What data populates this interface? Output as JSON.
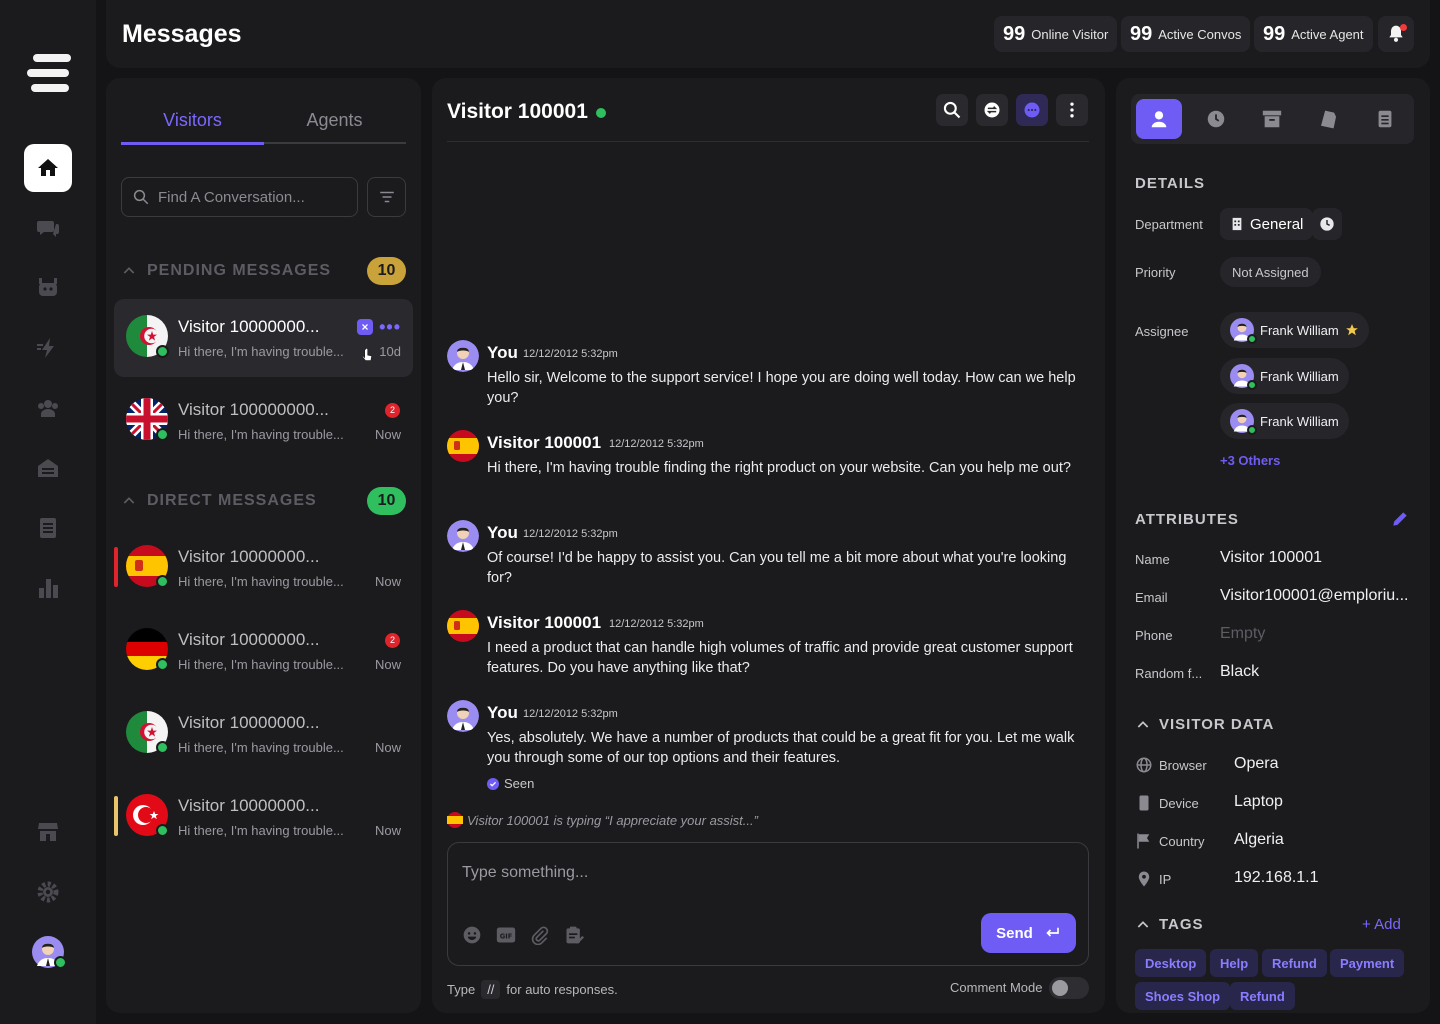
{
  "header": {
    "title": "Messages",
    "stats": [
      {
        "value": "99",
        "label": "Online Visitor"
      },
      {
        "value": "99",
        "label": "Active Convos"
      },
      {
        "value": "99",
        "label": "Active Agent"
      }
    ]
  },
  "sidebar_nav": [
    "home-icon",
    "chat-icon",
    "bot-icon",
    "lightning-icon",
    "team-icon",
    "inbox-icon",
    "document-icon",
    "analytics-icon",
    "store-icon",
    "settings-icon",
    "profile-avatar"
  ],
  "left": {
    "tabs": [
      "Visitors",
      "Agents"
    ],
    "active_tab": "Visitors",
    "search_placeholder": "Find A Conversation...",
    "pending": {
      "label": "PENDING MESSAGES",
      "count": "10"
    },
    "direct": {
      "label": "DIRECT MESSAGES",
      "count": "10"
    },
    "pending_items": [
      {
        "name": "Visitor 10000000...",
        "preview": "Hi there, I'm having trouble...",
        "time": "10d",
        "flag": "algeria",
        "badge": ""
      },
      {
        "name": "Visitor 100000000...",
        "preview": "Hi there, I'm having trouble...",
        "time": "Now",
        "flag": "uk",
        "badge": "2"
      }
    ],
    "direct_items": [
      {
        "name": "Visitor 10000000...",
        "preview": "Hi there, I'm having trouble...",
        "time": "Now",
        "flag": "spain",
        "badge": "",
        "stripe": "#e0242b"
      },
      {
        "name": "Visitor 10000000...",
        "preview": "Hi there, I'm having trouble...",
        "time": "Now",
        "flag": "germany",
        "badge": "2",
        "stripe": ""
      },
      {
        "name": "Visitor 10000000...",
        "preview": "Hi there, I'm having trouble...",
        "time": "Now",
        "flag": "algeria",
        "badge": "",
        "stripe": ""
      },
      {
        "name": "Visitor 10000000...",
        "preview": "Hi there, I'm having trouble...",
        "time": "Now",
        "flag": "turkey",
        "badge": "",
        "stripe": "#e8c46a"
      }
    ]
  },
  "chat": {
    "title": "Visitor 100001",
    "messages": [
      {
        "sender": "You",
        "time": "12/12/2012 5:32pm",
        "text": "Hello sir, Welcome to the support service! I hope you are doing well today. How can we help you?",
        "avatar": "agent"
      },
      {
        "sender": "Visitor 100001",
        "time": "12/12/2012 5:32pm",
        "text": "Hi there, I'm having trouble finding the right product on your website. Can you help me out?",
        "avatar": "spain"
      },
      {
        "sender": "You",
        "time": "12/12/2012 5:32pm",
        "text": "Of course! I'd be happy to assist you. Can you tell me a bit more about what you're looking for?",
        "avatar": "agent"
      },
      {
        "sender": "Visitor 100001",
        "time": "12/12/2012 5:32pm",
        "text": "I need a product that can handle high volumes of traffic and provide great customer support features. Do you have anything like that?",
        "avatar": "spain"
      },
      {
        "sender": "You",
        "time": "12/12/2012 5:32pm",
        "text": "Yes, absolutely. We have a number of products that could be a great fit for you. Let me walk you through some of our top options and their features.",
        "avatar": "agent"
      }
    ],
    "seen": "Seen",
    "typing": "Visitor 100001 is typing “I appreciate your assist...”",
    "composer_placeholder": "Type something...",
    "send_label": "Send",
    "hint_before": "Type",
    "hint_key": "//",
    "hint_after": "for auto responses.",
    "comment_mode": "Comment Mode"
  },
  "details": {
    "heading": "DETAILS",
    "department_label": "Department",
    "department_value": "General",
    "priority_label": "Priority",
    "priority_value": "Not Assigned",
    "assignee_label": "Assignee",
    "assignees": [
      "Frank William",
      "Frank William",
      "Frank William"
    ],
    "others": "+3 Others"
  },
  "attributes": {
    "heading": "ATTRIBUTES",
    "rows": [
      {
        "k": "Name",
        "v": "Visitor 100001"
      },
      {
        "k": "Email",
        "v": "Visitor100001@emploriu..."
      },
      {
        "k": "Phone",
        "v": "Empty"
      },
      {
        "k": "Random f...",
        "v": "Black"
      }
    ]
  },
  "visitor_data": {
    "heading": "VISITOR DATA",
    "rows": [
      {
        "k": "Browser",
        "v": "Opera",
        "icon": "globe-icon"
      },
      {
        "k": "Device",
        "v": "Laptop",
        "icon": "device-icon"
      },
      {
        "k": "Country",
        "v": "Algeria",
        "icon": "flag-icon"
      },
      {
        "k": "IP",
        "v": "192.168.1.1",
        "icon": "location-pin-icon"
      }
    ]
  },
  "tags": {
    "heading": "TAGS",
    "add_label": "+ Add",
    "items": [
      "Desktop",
      "Help",
      "Refund",
      "Payment",
      "Shoes Shop",
      "Refund"
    ]
  },
  "colors": {
    "accent": "#6f5cf5",
    "online": "#2fbf5f",
    "pending_badge": "#c9a23a",
    "direct_badge": "#2fbf5f"
  }
}
